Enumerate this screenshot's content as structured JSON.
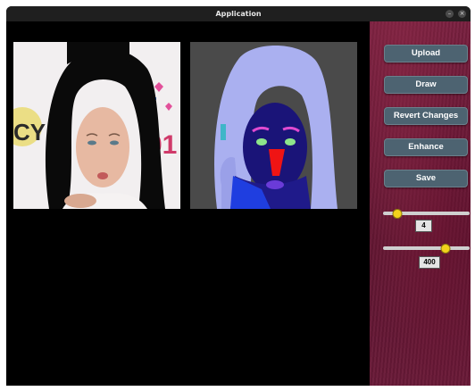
{
  "window": {
    "title": "Application",
    "minimize_icon": "–",
    "close_icon": "×"
  },
  "images": {
    "source_photo": "portrait-photo",
    "segmentation_mask": "face-parsing-mask"
  },
  "controls": {
    "upload_label": "Upload",
    "draw_label": "Draw",
    "revert_label": "Revert Changes",
    "enhance_label": "Enhance",
    "save_label": "Save"
  },
  "sliders": [
    {
      "value_label": "4",
      "fraction": 0.17
    },
    {
      "value_label": "400",
      "fraction": 0.72
    }
  ],
  "colors": {
    "thumb": "#f2d21c",
    "button": "#4d6371",
    "mask_background": "#4a4a4a"
  }
}
